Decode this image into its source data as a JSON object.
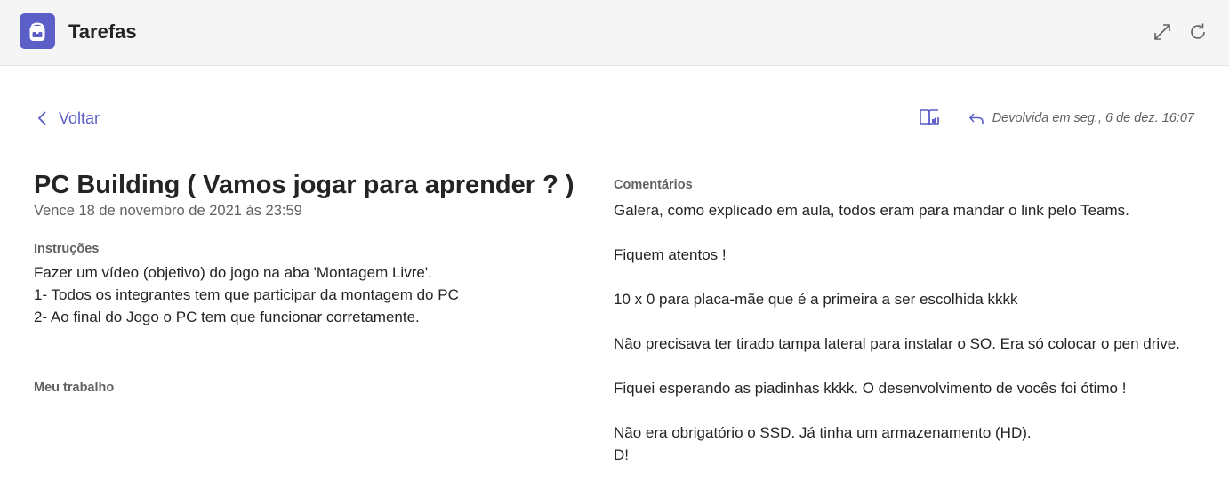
{
  "header": {
    "app_title": "Tarefas",
    "logo_icon": "backpack-icon",
    "expand_icon": "expand-icon",
    "refresh_icon": "refresh-icon",
    "accent": "#5b5fc7"
  },
  "nav": {
    "back_label": "Voltar",
    "back_icon": "chevron-left-icon"
  },
  "toolbar": {
    "reader_icon": "immersive-reader-icon",
    "returned_icon": "reply-icon",
    "returned_text": "Devolvida em seg., 6 de dez. 16:07"
  },
  "assignment": {
    "title": "PC Building ( Vamos jogar para aprender ? )",
    "due": "Vence 18 de novembro de 2021 às 23:59",
    "instructions_label": "Instruções",
    "instructions": [
      "Fazer um vídeo (objetivo) do jogo na aba 'Montagem Livre'.",
      "1- Todos os integrantes tem que participar da montagem do PC",
      "2- Ao final do Jogo o PC tem que funcionar corretamente."
    ],
    "my_work_label": "Meu trabalho"
  },
  "comments": {
    "label": "Comentários",
    "lines": [
      "Galera, como explicado em aula, todos eram para mandar o link pelo Teams.",
      "Fiquem atentos !",
      "10 x 0 para placa-mãe que é a primeira a ser escolhida kkkk",
      "Não precisava ter tirado tampa lateral para instalar o SO. Era só colocar o pen drive.",
      "Fiquei esperando as piadinhas kkkk. O desenvolvimento de vocês foi ótimo !",
      "Não era obrigatório o SSD. Já tinha um armazenamento (HD).",
      "D!"
    ]
  }
}
